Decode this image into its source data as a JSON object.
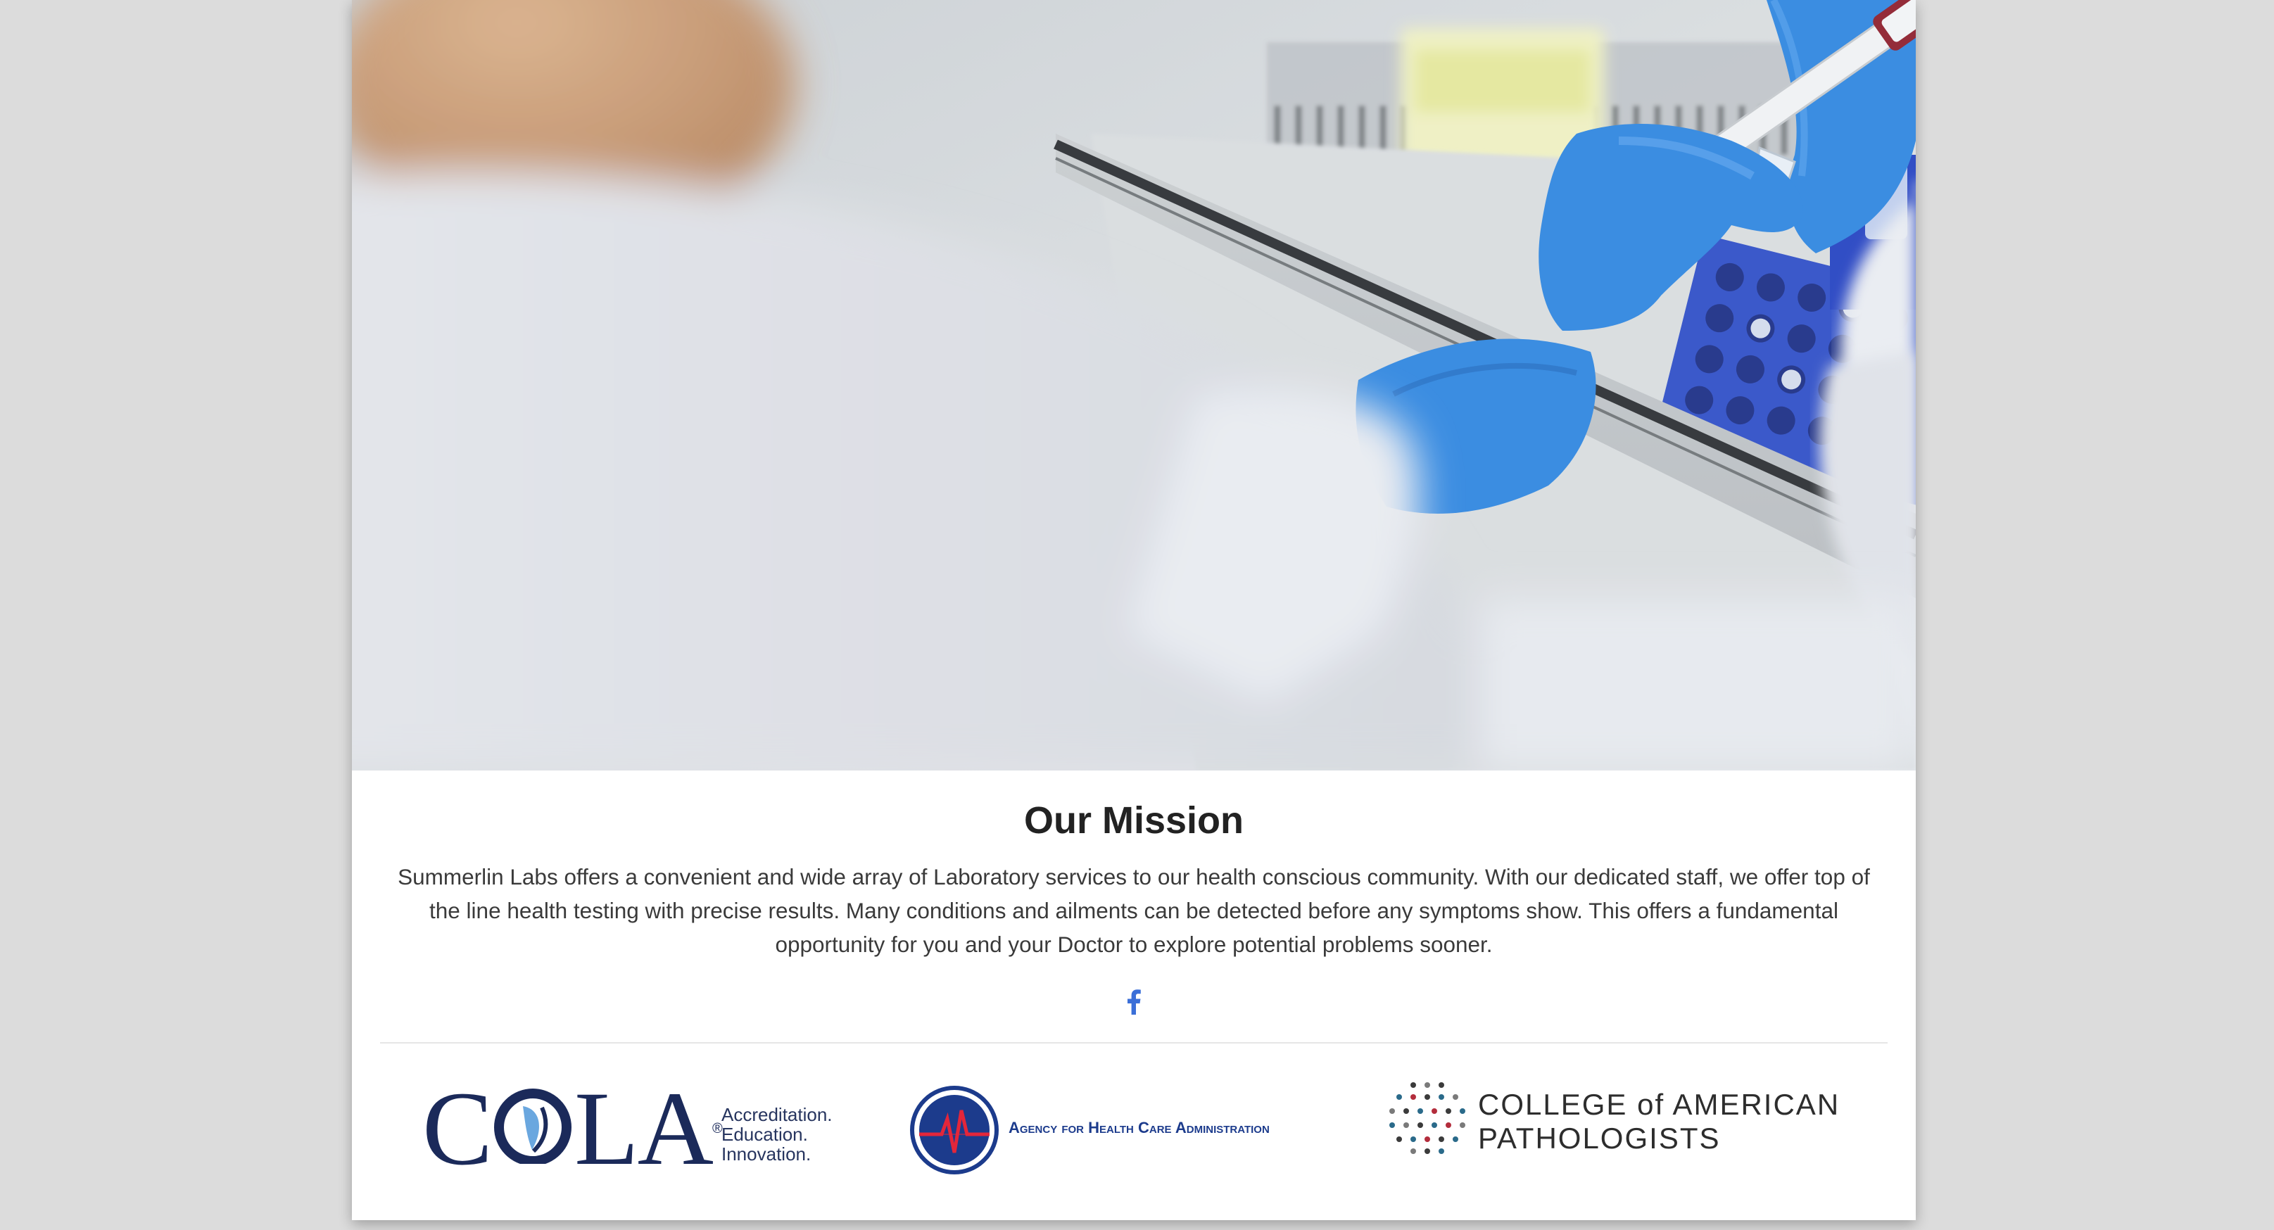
{
  "hero": {
    "image_description": "lab technician in blue gloves pipetting into sample tubes"
  },
  "mission": {
    "title": "Our Mission",
    "body": "Summerlin Labs offers a convenient and wide array of Laboratory services to our health conscious community. With our dedicated staff, we offer top of the line health testing with precise results. Many conditions and ailments can be detected before any symptoms show. This offers a fundamental opportunity for you and your Doctor to explore potential problems sooner."
  },
  "social": {
    "facebook_icon": "facebook-icon",
    "color": "#3b6fd8"
  },
  "accreditations": {
    "cola": {
      "name_part1": "C",
      "name_part2": "LA",
      "registered": "®",
      "tagline_line1": "Accreditation.",
      "tagline_line2": "Education.",
      "tagline_line3": "Innovation."
    },
    "ahca": {
      "name": "Agency for Health Care Administration"
    },
    "cap": {
      "line1": "COLLEGE of AMERICAN",
      "line2": "PATHOLOGISTS"
    }
  },
  "colors": {
    "page_background": "#dcdcdc",
    "glove_blue": "#2f86e0",
    "cola_navy": "#1b2a5a",
    "ahca_blue": "#1c3b8c"
  }
}
